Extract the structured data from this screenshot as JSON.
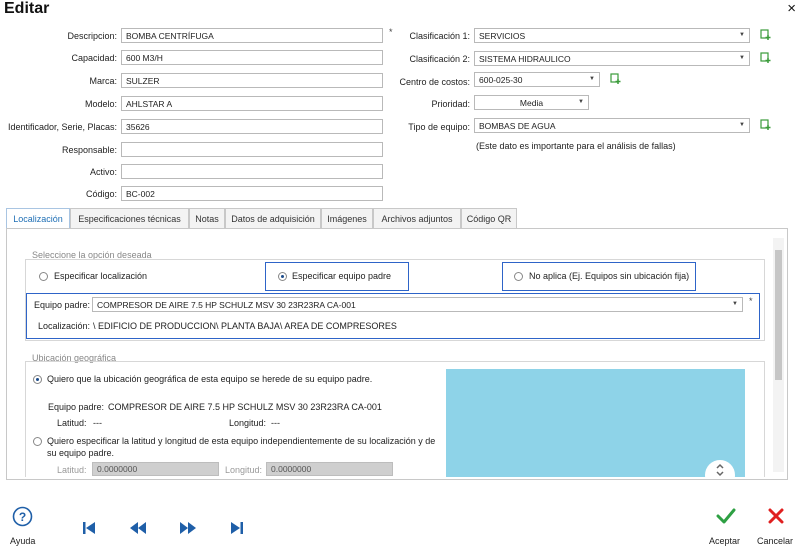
{
  "window": {
    "title": "Editar",
    "close_icon": "×"
  },
  "left_form": {
    "descripcion": {
      "label": "Descripcion:",
      "value": "BOMBA CENTRÍFUGA",
      "required": "*"
    },
    "capacidad": {
      "label": "Capacidad:",
      "value": "600 M3/H"
    },
    "marca": {
      "label": "Marca:",
      "value": "SULZER"
    },
    "modelo": {
      "label": "Modelo:",
      "value": "AHLSTAR A"
    },
    "identificador": {
      "label": "Identificador, Serie, Placas:",
      "value": "35626"
    },
    "responsable": {
      "label": "Responsable:",
      "value": ""
    },
    "activo": {
      "label": "Activo:",
      "value": ""
    },
    "codigo": {
      "label": "Código:",
      "value": "BC-002"
    }
  },
  "right_form": {
    "clasificacion1": {
      "label": "Clasificación 1:",
      "value": "SERVICIOS"
    },
    "clasificacion2": {
      "label": "Clasificación 2:",
      "value": "SISTEMA HIDRAULICO"
    },
    "centro_costos": {
      "label": "Centro de costos:",
      "value": "600-025-30"
    },
    "prioridad": {
      "label": "Prioridad:",
      "value": "Media"
    },
    "tipo_equipo": {
      "label": "Tipo de equipo:",
      "value": "BOMBAS DE AGUA"
    },
    "note": "(Este dato es importante para el análisis de fallas)"
  },
  "tabs": [
    "Localización",
    "Especificaciones técnicas",
    "Notas",
    "Datos de adquisición",
    "Imágenes",
    "Archivos adjuntos",
    "Código QR"
  ],
  "localizacion": {
    "section_title": "Seleccione la opción deseada",
    "option1": "Especificar localización",
    "option2": "Especificar equipo padre",
    "option3": "No aplica (Ej. Equipos sin ubicación fija)",
    "equipo_padre_label": "Equipo padre:",
    "equipo_padre_value": "COMPRESOR DE AIRE 7.5 HP SCHULZ MSV 30 23R23RA CA-001",
    "required": "*",
    "localizacion_label": "Localización:",
    "localizacion_value": "\\ EDIFICIO DE PRODUCCION\\ PLANTA BAJA\\ AREA DE COMPRESORES"
  },
  "geo": {
    "section_title": "Ubicación geográfica",
    "option_inherit": "Quiero que la ubicación geográfica de esta equipo se herede de su equipo padre.",
    "equipo_padre_label": "Equipo padre:",
    "equipo_padre_value": "COMPRESOR DE AIRE 7.5 HP SCHULZ MSV 30 23R23RA CA-001",
    "latitud_label": "Latitud:",
    "latitud_value": "---",
    "longitud_label": "Longitud:",
    "longitud_value": "---",
    "option_specify_line1": "Quiero especificar la latitud y longitud de esta equipo independientemente de su localización y de",
    "option_specify_line2": "su equipo padre.",
    "lat_input_label": "Latitud:",
    "lat_input_value": "0.0000000",
    "lon_input_label": "Longitud:",
    "lon_input_value": "0.0000000"
  },
  "footer": {
    "help_label": "Ayuda",
    "accept_label": "Aceptar",
    "cancel_label": "Cancelar"
  },
  "colors": {
    "accent": "#1f6fb5",
    "accept": "#2ea043",
    "cancel": "#e02020",
    "map": "#8ed3e8",
    "highlight": "#2e64c8"
  }
}
